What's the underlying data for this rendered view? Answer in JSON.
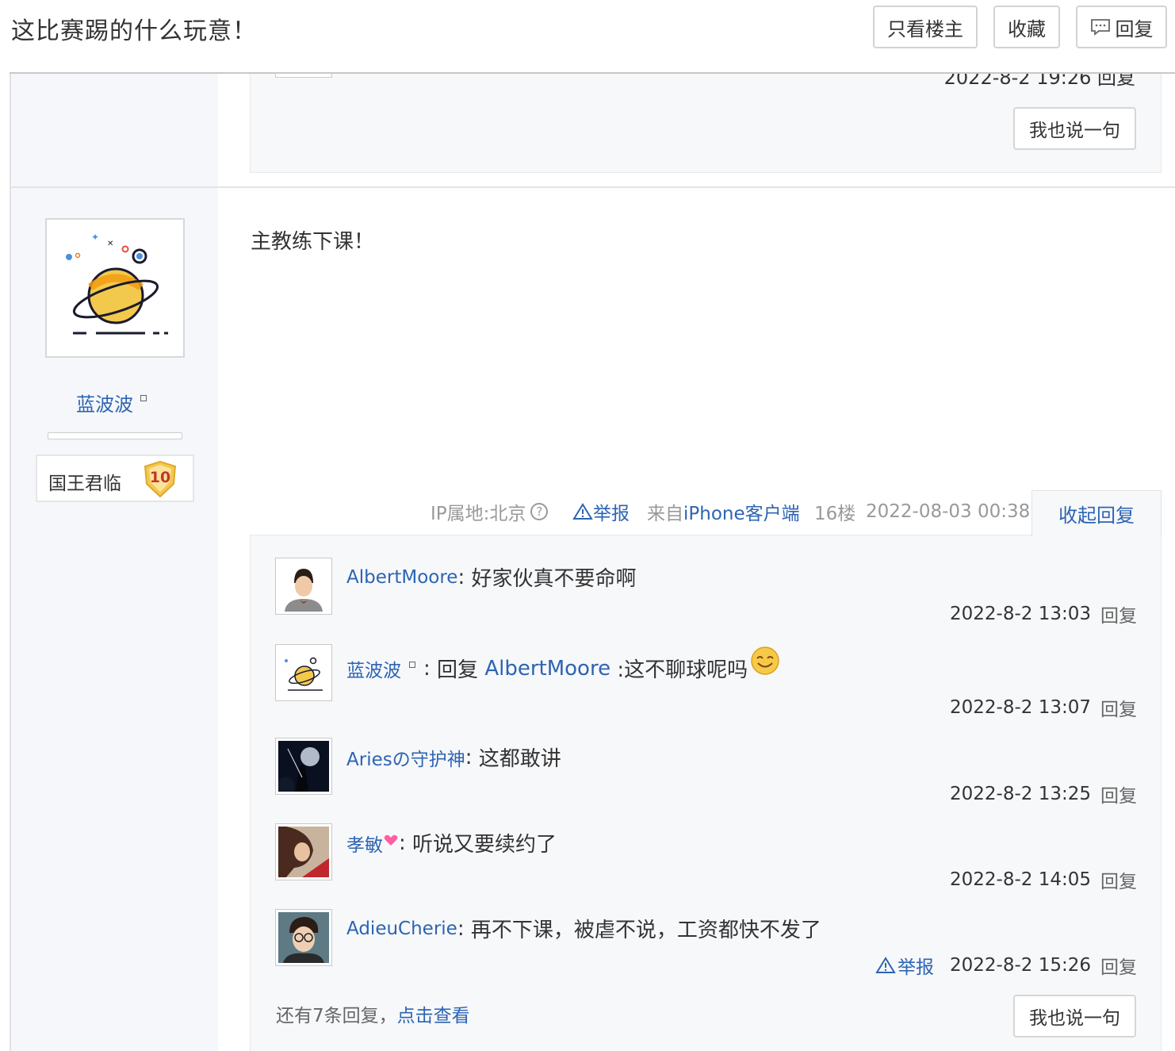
{
  "header": {
    "title": "这比赛踢的什么玩意！",
    "only_op_label": "只看楼主",
    "favorite_label": "收藏",
    "reply_label": "回复"
  },
  "prev_floor": {
    "partial_time": "2022-8-2 19:26 回复",
    "say_label": "我也说一句"
  },
  "author": {
    "name": "蓝波波",
    "rank_title": "国王君临",
    "level": "10"
  },
  "post": {
    "content": "主教练下课！",
    "ip_location": "IP属地:北京",
    "report_label": "举报",
    "source_prefix": "来自",
    "source_client": "iPhone客户端",
    "floor": "16楼",
    "datetime": "2022-08-03 00:38",
    "collapse_label": "收起回复"
  },
  "replies": [
    {
      "user": "AlbertMoore",
      "text": "好家伙真不要命啊",
      "time": "2022-8-2 13:03",
      "reply_label": "回复"
    },
    {
      "user": "蓝波波",
      "reply_word": "回复",
      "target": "AlbertMoore",
      "text": ":这不聊球呢吗",
      "time": "2022-8-2 13:07",
      "reply_label": "回复"
    },
    {
      "user": "Ariesの守护神",
      "text": "这都敢讲",
      "time": "2022-8-2 13:25",
      "reply_label": "回复"
    },
    {
      "user": "孝敏",
      "text": "听说又要续约了",
      "time": "2022-8-2 14:05",
      "reply_label": "回复"
    },
    {
      "user": "AdieuCherie",
      "text": "再不下课，被虐不说，工资都快不发了",
      "time": "2022-8-2 15:26",
      "reply_label": "回复",
      "report_label": "举报"
    }
  ],
  "more": {
    "prefix": "还有7条回复，",
    "link": "点击查看",
    "say_label": "我也说一句"
  },
  "colors": {
    "link_blue": "#2d64b3",
    "reply_bg": "#f7f8fa",
    "sidebar_bg": "#f5f7fa",
    "badge_gold": "#f2c94c"
  }
}
